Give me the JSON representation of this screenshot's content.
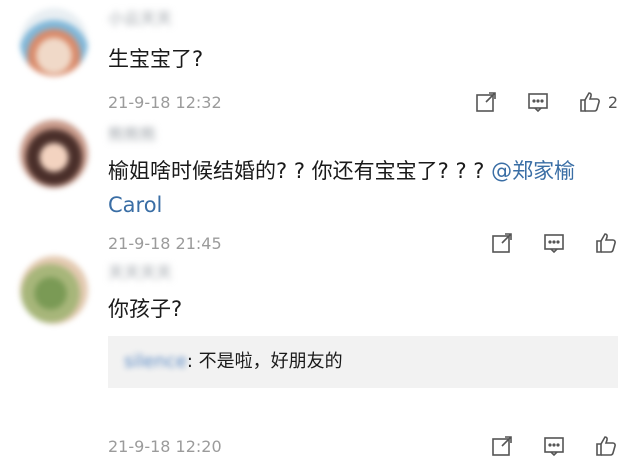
{
  "comments": [
    {
      "username": "小云天天",
      "text": "生宝宝了?",
      "date": "21-9-18 12:32",
      "like_count": "2"
    },
    {
      "username": "熊熊熊",
      "text": "榆姐啥时候结婚的? ? 你还有宝宝了? ? ? ",
      "mention": "@郑家榆 Carol",
      "date": "21-9-18 21:45",
      "like_count": ""
    },
    {
      "username": "天天天天",
      "text": "你孩子?",
      "reply": {
        "name": "silence",
        "text": ": 不是啦，好朋友的"
      },
      "date": "21-9-18 12:20",
      "like_count": ""
    }
  ],
  "icons": {
    "share": "share-icon",
    "comment": "comment-icon",
    "like": "thumbs-up-icon"
  }
}
